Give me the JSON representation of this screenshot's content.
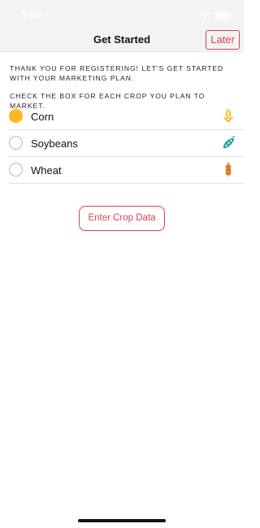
{
  "status_bar": {
    "time": "5:56"
  },
  "nav": {
    "title": "Get Started",
    "later_label": "Later"
  },
  "intro_text": "THANK YOU FOR REGISTERING! LET'S GET STARTED WITH YOUR MARKETING PLAN.",
  "instruction_text": "CHECK THE BOX FOR EACH CROP YOU PLAN TO MARKET.",
  "crops": [
    {
      "label": "Corn",
      "checked": true,
      "icon": "corn-icon",
      "icon_color": "#f5b21b"
    },
    {
      "label": "Soybeans",
      "checked": false,
      "icon": "soybean-icon",
      "icon_color": "#1aa39a"
    },
    {
      "label": "Wheat",
      "checked": false,
      "icon": "wheat-icon",
      "icon_color": "#e07b1a"
    }
  ],
  "enter_button_label": "Enter Crop Data",
  "colors": {
    "accent_red": "#d9434a",
    "checked_yellow": "#fbb91f"
  }
}
